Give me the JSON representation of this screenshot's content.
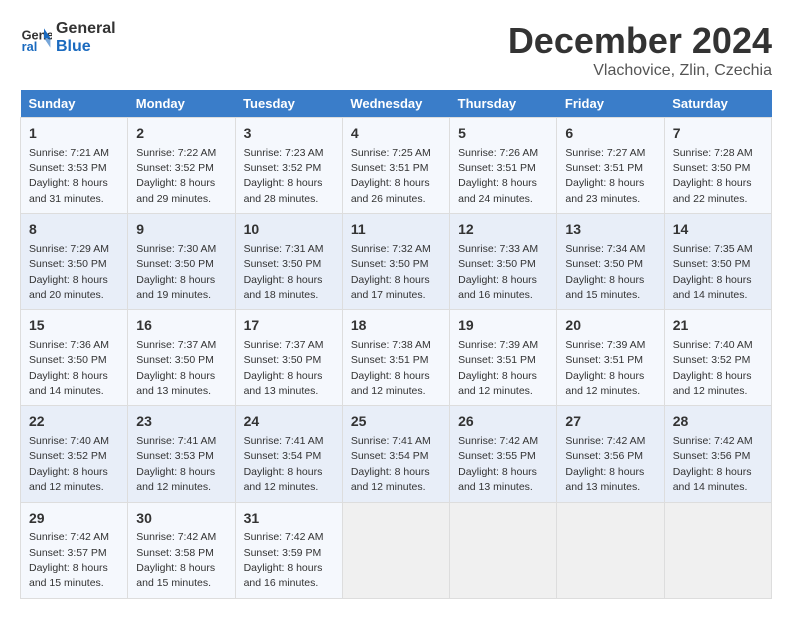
{
  "logo": {
    "line1": "General",
    "line2": "Blue"
  },
  "title": "December 2024",
  "subtitle": "Vlachovice, Zlin, Czechia",
  "days_header": [
    "Sunday",
    "Monday",
    "Tuesday",
    "Wednesday",
    "Thursday",
    "Friday",
    "Saturday"
  ],
  "weeks": [
    [
      {
        "day": "1",
        "sunrise": "7:21 AM",
        "sunset": "3:53 PM",
        "daylight": "8 hours and 31 minutes."
      },
      {
        "day": "2",
        "sunrise": "7:22 AM",
        "sunset": "3:52 PM",
        "daylight": "8 hours and 29 minutes."
      },
      {
        "day": "3",
        "sunrise": "7:23 AM",
        "sunset": "3:52 PM",
        "daylight": "8 hours and 28 minutes."
      },
      {
        "day": "4",
        "sunrise": "7:25 AM",
        "sunset": "3:51 PM",
        "daylight": "8 hours and 26 minutes."
      },
      {
        "day": "5",
        "sunrise": "7:26 AM",
        "sunset": "3:51 PM",
        "daylight": "8 hours and 24 minutes."
      },
      {
        "day": "6",
        "sunrise": "7:27 AM",
        "sunset": "3:51 PM",
        "daylight": "8 hours and 23 minutes."
      },
      {
        "day": "7",
        "sunrise": "7:28 AM",
        "sunset": "3:50 PM",
        "daylight": "8 hours and 22 minutes."
      }
    ],
    [
      {
        "day": "8",
        "sunrise": "7:29 AM",
        "sunset": "3:50 PM",
        "daylight": "8 hours and 20 minutes."
      },
      {
        "day": "9",
        "sunrise": "7:30 AM",
        "sunset": "3:50 PM",
        "daylight": "8 hours and 19 minutes."
      },
      {
        "day": "10",
        "sunrise": "7:31 AM",
        "sunset": "3:50 PM",
        "daylight": "8 hours and 18 minutes."
      },
      {
        "day": "11",
        "sunrise": "7:32 AM",
        "sunset": "3:50 PM",
        "daylight": "8 hours and 17 minutes."
      },
      {
        "day": "12",
        "sunrise": "7:33 AM",
        "sunset": "3:50 PM",
        "daylight": "8 hours and 16 minutes."
      },
      {
        "day": "13",
        "sunrise": "7:34 AM",
        "sunset": "3:50 PM",
        "daylight": "8 hours and 15 minutes."
      },
      {
        "day": "14",
        "sunrise": "7:35 AM",
        "sunset": "3:50 PM",
        "daylight": "8 hours and 14 minutes."
      }
    ],
    [
      {
        "day": "15",
        "sunrise": "7:36 AM",
        "sunset": "3:50 PM",
        "daylight": "8 hours and 14 minutes."
      },
      {
        "day": "16",
        "sunrise": "7:37 AM",
        "sunset": "3:50 PM",
        "daylight": "8 hours and 13 minutes."
      },
      {
        "day": "17",
        "sunrise": "7:37 AM",
        "sunset": "3:50 PM",
        "daylight": "8 hours and 13 minutes."
      },
      {
        "day": "18",
        "sunrise": "7:38 AM",
        "sunset": "3:51 PM",
        "daylight": "8 hours and 12 minutes."
      },
      {
        "day": "19",
        "sunrise": "7:39 AM",
        "sunset": "3:51 PM",
        "daylight": "8 hours and 12 minutes."
      },
      {
        "day": "20",
        "sunrise": "7:39 AM",
        "sunset": "3:51 PM",
        "daylight": "8 hours and 12 minutes."
      },
      {
        "day": "21",
        "sunrise": "7:40 AM",
        "sunset": "3:52 PM",
        "daylight": "8 hours and 12 minutes."
      }
    ],
    [
      {
        "day": "22",
        "sunrise": "7:40 AM",
        "sunset": "3:52 PM",
        "daylight": "8 hours and 12 minutes."
      },
      {
        "day": "23",
        "sunrise": "7:41 AM",
        "sunset": "3:53 PM",
        "daylight": "8 hours and 12 minutes."
      },
      {
        "day": "24",
        "sunrise": "7:41 AM",
        "sunset": "3:54 PM",
        "daylight": "8 hours and 12 minutes."
      },
      {
        "day": "25",
        "sunrise": "7:41 AM",
        "sunset": "3:54 PM",
        "daylight": "8 hours and 12 minutes."
      },
      {
        "day": "26",
        "sunrise": "7:42 AM",
        "sunset": "3:55 PM",
        "daylight": "8 hours and 13 minutes."
      },
      {
        "day": "27",
        "sunrise": "7:42 AM",
        "sunset": "3:56 PM",
        "daylight": "8 hours and 13 minutes."
      },
      {
        "day": "28",
        "sunrise": "7:42 AM",
        "sunset": "3:56 PM",
        "daylight": "8 hours and 14 minutes."
      }
    ],
    [
      {
        "day": "29",
        "sunrise": "7:42 AM",
        "sunset": "3:57 PM",
        "daylight": "8 hours and 15 minutes."
      },
      {
        "day": "30",
        "sunrise": "7:42 AM",
        "sunset": "3:58 PM",
        "daylight": "8 hours and 15 minutes."
      },
      {
        "day": "31",
        "sunrise": "7:42 AM",
        "sunset": "3:59 PM",
        "daylight": "8 hours and 16 minutes."
      },
      null,
      null,
      null,
      null
    ]
  ]
}
